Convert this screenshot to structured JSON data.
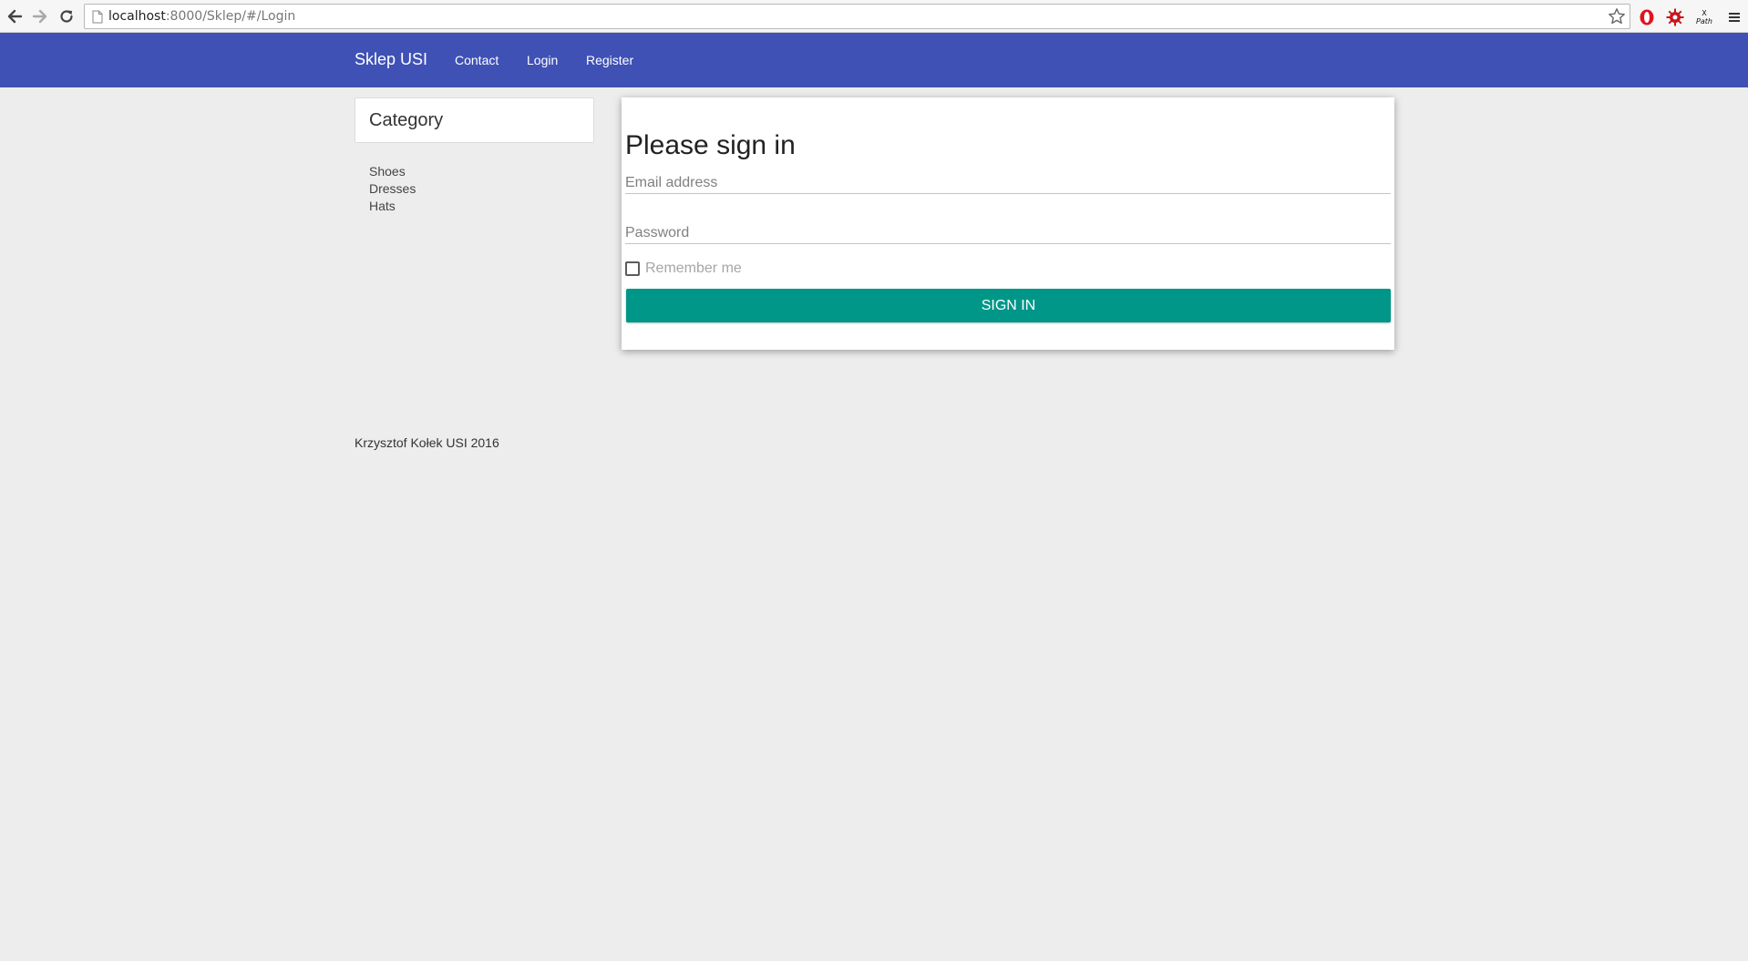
{
  "browser": {
    "url_host": "localhost",
    "url_rest": ":8000/Sklep/#/Login"
  },
  "navbar": {
    "brand": "Sklep USI",
    "links": [
      "Contact",
      "Login",
      "Register"
    ],
    "color": "#3f51b5"
  },
  "sidebar": {
    "title": "Category",
    "items": [
      "Shoes",
      "Dresses",
      "Hats"
    ]
  },
  "login": {
    "title": "Please sign in",
    "email_placeholder": "Email address",
    "password_placeholder": "Password",
    "remember_label": "Remember me",
    "remember_checked": false,
    "submit_label": "Sign in",
    "button_color": "#009688"
  },
  "footer": {
    "text": "Krzysztof Kołek USI 2016"
  },
  "icons": [
    "back-arrow-icon",
    "forward-arrow-icon",
    "reload-icon",
    "page-icon",
    "star-icon",
    "opera-icon",
    "gear-extension-icon",
    "xpath-extension-icon",
    "menu-icon"
  ]
}
